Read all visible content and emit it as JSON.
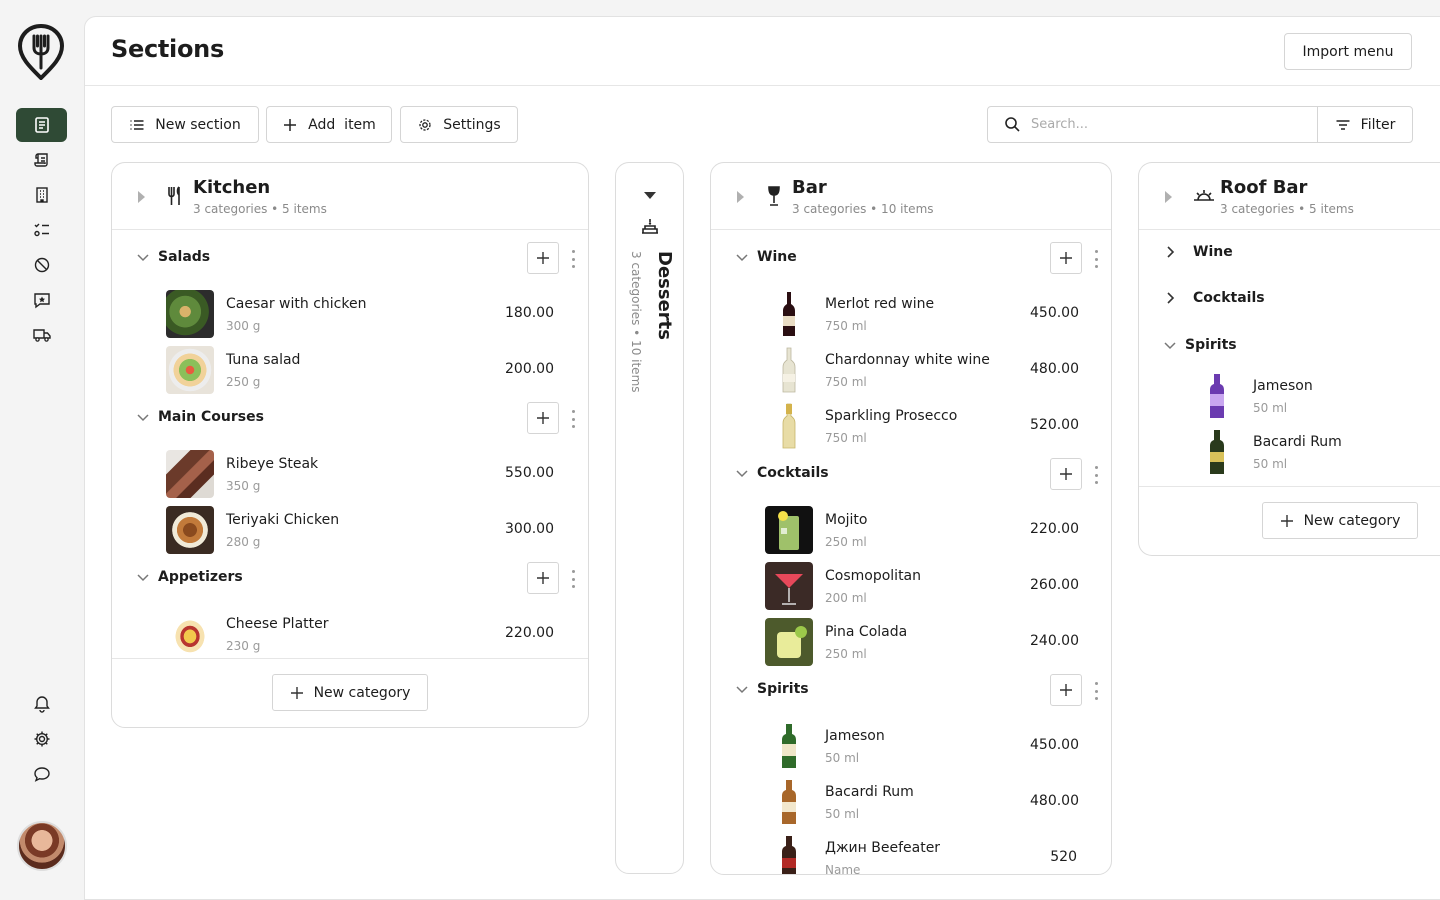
{
  "page": {
    "title": "Sections",
    "import_label": "Import menu"
  },
  "toolbar": {
    "new_section": "New section",
    "add_item": "Add  item",
    "settings": "Settings",
    "search_placeholder": "Search...",
    "filter": "Filter"
  },
  "nav": {
    "items": [
      "menu-icon",
      "scroll-icon",
      "building-icon",
      "checklist-icon",
      "block-icon",
      "chat-star-icon",
      "truck-icon"
    ],
    "bottom": [
      "bell-icon",
      "gear-icon",
      "speech-bubble-icon"
    ],
    "active_color": "#2f4a35"
  },
  "kitchen": {
    "title": "Kitchen",
    "subtitle": "3 categories • 5 items",
    "categories": [
      {
        "name": "Salads",
        "items": [
          {
            "name": "Caesar with chicken",
            "meta": "300 g",
            "price": "180.00"
          },
          {
            "name": "Tuna salad",
            "meta": "250 g",
            "price": "200.00"
          }
        ]
      },
      {
        "name": "Main Courses",
        "items": [
          {
            "name": "Ribeye Steak",
            "meta": "350 g",
            "price": "550.00"
          },
          {
            "name": "Teriyaki Chicken",
            "meta": "280 g",
            "price": "300.00"
          }
        ]
      },
      {
        "name": "Appetizers",
        "items": [
          {
            "name": "Cheese Platter",
            "meta": "230 g",
            "price": "220.00"
          }
        ]
      }
    ],
    "new_category": "New category"
  },
  "desserts": {
    "title": "Desserts",
    "subtitle": "3 categories • 10 items"
  },
  "bar": {
    "title": "Bar",
    "subtitle": "3 categories • 10 items",
    "categories": [
      {
        "name": "Wine",
        "items": [
          {
            "name": "Merlot red wine",
            "meta": "750 ml",
            "price": "450.00"
          },
          {
            "name": "Chardonnay white wine",
            "meta": "750 ml",
            "price": "480.00"
          },
          {
            "name": "Sparkling Prosecco",
            "meta": "750 ml",
            "price": "520.00"
          }
        ]
      },
      {
        "name": "Cocktails",
        "items": [
          {
            "name": "Mojito",
            "meta": "250 ml",
            "price": "220.00"
          },
          {
            "name": "Cosmopolitan",
            "meta": "200 ml",
            "price": "260.00"
          },
          {
            "name": "Pina Colada",
            "meta": "250 ml",
            "price": "240.00"
          }
        ]
      },
      {
        "name": "Spirits",
        "items": [
          {
            "name": "Jameson",
            "meta": "50 ml",
            "price": "450.00"
          },
          {
            "name": "Bacardi Rum",
            "meta": "50 ml",
            "price": "480.00"
          },
          {
            "name": "Джин Beefeater",
            "meta": "Name",
            "price": "520"
          }
        ]
      }
    ]
  },
  "roofbar": {
    "title": "Roof Bar",
    "subtitle": "3 categories • 5 items",
    "categories": [
      {
        "name": "Wine"
      },
      {
        "name": "Cocktails"
      },
      {
        "name": "Spirits",
        "items": [
          {
            "name": "Jameson",
            "meta": "50 ml"
          },
          {
            "name": "Bacardi Rum",
            "meta": "50 ml"
          }
        ]
      }
    ],
    "new_category": "New category"
  }
}
